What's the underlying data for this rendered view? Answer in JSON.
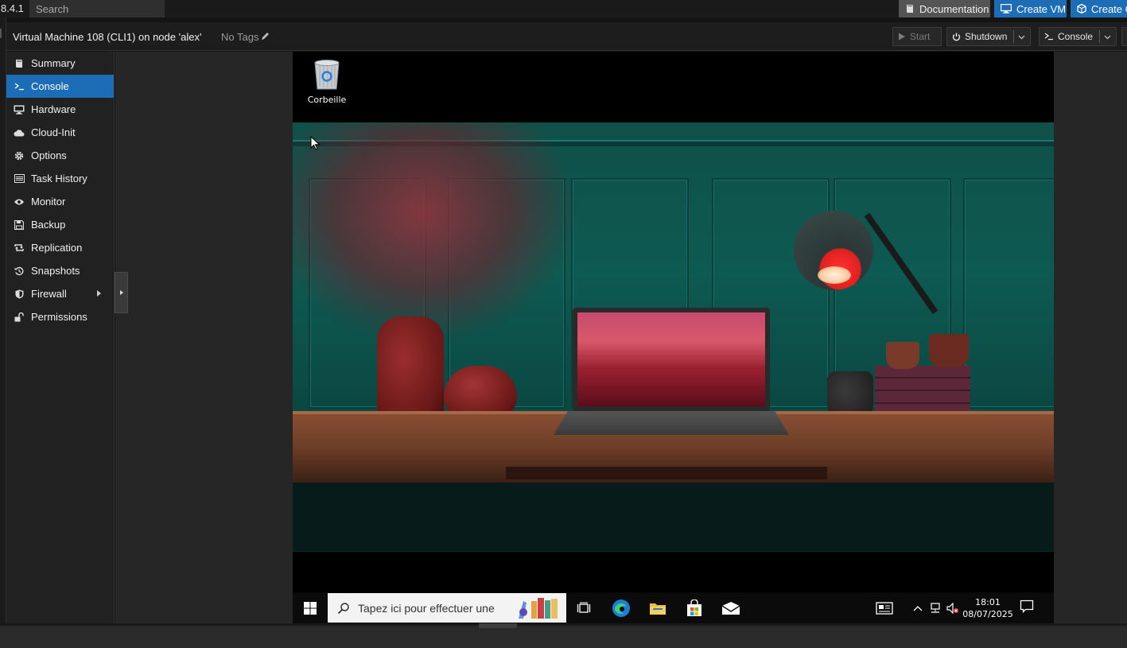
{
  "header": {
    "version": "8.4.1",
    "search_placeholder": "Search",
    "buttons": {
      "documentation": "Documentation",
      "create_vm": "Create VM",
      "create_ct": "Create C"
    }
  },
  "titlebar": {
    "title": "Virtual Machine 108 (CLI1) on node 'alex'",
    "tags": "No Tags",
    "start": "Start",
    "shutdown": "Shutdown",
    "console": "Console"
  },
  "nav": {
    "items": [
      {
        "label": "Summary",
        "icon": "book-icon"
      },
      {
        "label": "Console",
        "icon": "terminal-icon"
      },
      {
        "label": "Hardware",
        "icon": "desktop-icon"
      },
      {
        "label": "Cloud-Init",
        "icon": "cloud-icon"
      },
      {
        "label": "Options",
        "icon": "gear-icon"
      },
      {
        "label": "Task History",
        "icon": "list-icon"
      },
      {
        "label": "Monitor",
        "icon": "eye-icon"
      },
      {
        "label": "Backup",
        "icon": "floppy-icon"
      },
      {
        "label": "Replication",
        "icon": "retweet-icon"
      },
      {
        "label": "Snapshots",
        "icon": "history-icon"
      },
      {
        "label": "Firewall",
        "icon": "shield-icon"
      },
      {
        "label": "Permissions",
        "icon": "unlock-icon"
      }
    ],
    "active": "Console"
  },
  "vm_desktop": {
    "recycle_bin_label": "Corbeille",
    "taskbar": {
      "search_placeholder": "Tapez ici pour effectuer une",
      "time": "18:01",
      "date": "08/07/2025"
    }
  },
  "colors": {
    "accent": "#1c6cb6",
    "header_bg": "#1a1a1a",
    "panel_bg": "#212121"
  }
}
